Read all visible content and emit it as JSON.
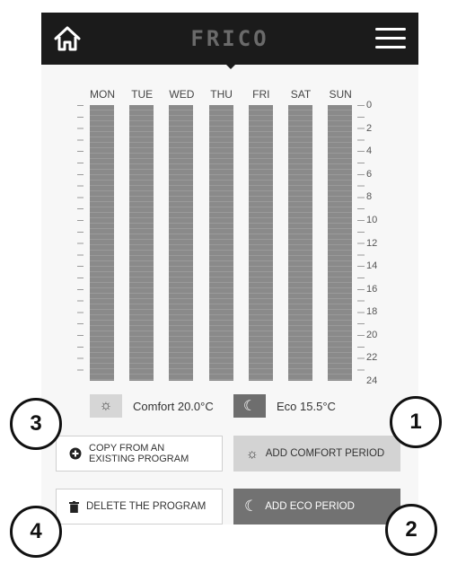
{
  "app": {
    "logo_text": "FRICO"
  },
  "icons": {
    "home": "home-icon",
    "menu": "hamburger-menu-icon",
    "comfort": "sun-icon",
    "eco": "moon-icon",
    "copy": "plus-circle-icon",
    "delete": "trash-icon"
  },
  "schedule": {
    "days": [
      "MON",
      "TUE",
      "WED",
      "THU",
      "FRI",
      "SAT",
      "SUN"
    ],
    "hour_labels": [
      "0",
      "2",
      "4",
      "6",
      "8",
      "10",
      "12",
      "14",
      "16",
      "18",
      "20",
      "22",
      "24"
    ]
  },
  "legend": {
    "comfort_label": "Comfort 20.0°C",
    "eco_label": "Eco 15.5°C"
  },
  "buttons": {
    "copy_line1": "COPY FROM AN",
    "copy_line2": "EXISTING PROGRAM",
    "add_comfort": "ADD COMFORT PERIOD",
    "delete_program": "DELETE THE PROGRAM",
    "add_eco": "ADD ECO PERIOD"
  },
  "callouts": [
    "1",
    "2",
    "3",
    "4"
  ],
  "colors": {
    "topbar": "#1b1b1b",
    "day_bar": "#8a8a8a",
    "comfort_button": "#d3d3d3",
    "eco_button": "#727272"
  }
}
